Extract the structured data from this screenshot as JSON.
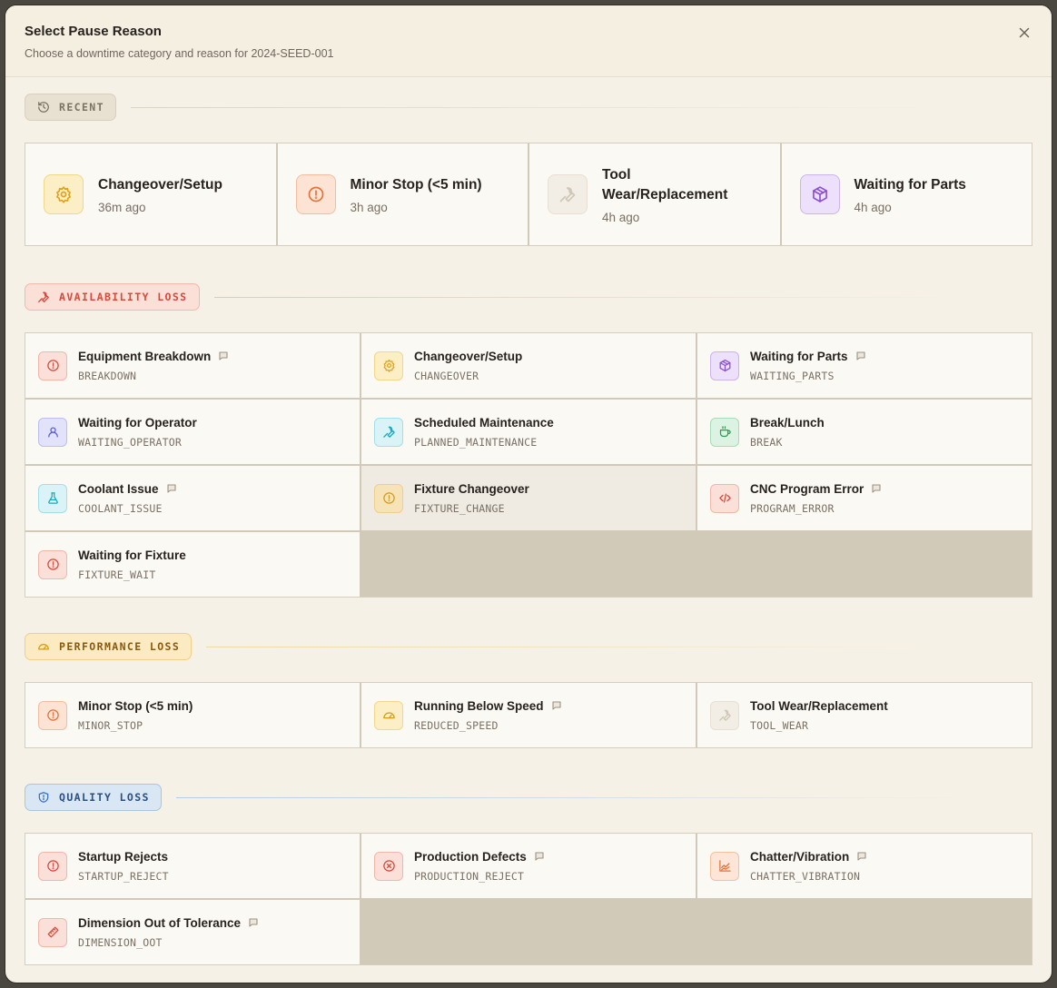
{
  "dialog": {
    "title": "Select Pause Reason",
    "subtitle": "Choose a downtime category and reason for 2024-SEED-001"
  },
  "recent": {
    "label": "RECENT",
    "items": [
      {
        "name": "Changeover/Setup",
        "time": "36m ago",
        "icon": "gear-icon",
        "color": "#e8a31c"
      },
      {
        "name": "Minor Stop (<5 min)",
        "time": "3h ago",
        "icon": "alert-circle-icon",
        "color": "#e0723a"
      },
      {
        "name": "Tool Wear/Replacement",
        "time": "4h ago",
        "icon": "wrench-icon",
        "color": "#c9bfae"
      },
      {
        "name": "Waiting for Parts",
        "time": "4h ago",
        "icon": "package-icon",
        "color": "#8b4fd1"
      }
    ]
  },
  "availability": {
    "label": "AVAILABILITY LOSS",
    "items": [
      {
        "name": "Equipment Breakdown",
        "code": "BREAKDOWN",
        "icon": "alert-circle-icon",
        "note": true
      },
      {
        "name": "Changeover/Setup",
        "code": "CHANGEOVER",
        "icon": "gear-icon",
        "note": false
      },
      {
        "name": "Waiting for Parts",
        "code": "WAITING_PARTS",
        "icon": "package-icon",
        "note": true
      },
      {
        "name": "Waiting for Operator",
        "code": "WAITING_OPERATOR",
        "icon": "user-icon",
        "note": false
      },
      {
        "name": "Scheduled Maintenance",
        "code": "PLANNED_MAINTENANCE",
        "icon": "wrench-icon",
        "note": false
      },
      {
        "name": "Break/Lunch",
        "code": "BREAK",
        "icon": "coffee-icon",
        "note": false
      },
      {
        "name": "Coolant Issue",
        "code": "COOLANT_ISSUE",
        "icon": "flask-icon",
        "note": true
      },
      {
        "name": "Fixture Changeover",
        "code": "FIXTURE_CHANGE",
        "icon": "alert-circle-icon",
        "note": false
      },
      {
        "name": "CNC Program Error",
        "code": "PROGRAM_ERROR",
        "icon": "code-icon",
        "note": true
      },
      {
        "name": "Waiting for Fixture",
        "code": "FIXTURE_WAIT",
        "icon": "alert-circle-icon",
        "note": false
      }
    ]
  },
  "performance": {
    "label": "PERFORMANCE LOSS",
    "items": [
      {
        "name": "Minor Stop (<5 min)",
        "code": "MINOR_STOP",
        "icon": "alert-circle-icon",
        "note": false
      },
      {
        "name": "Running Below Speed",
        "code": "REDUCED_SPEED",
        "icon": "gauge-icon",
        "note": true
      },
      {
        "name": "Tool Wear/Replacement",
        "code": "TOOL_WEAR",
        "icon": "wrench-icon",
        "note": false
      }
    ]
  },
  "quality": {
    "label": "QUALITY LOSS",
    "items": [
      {
        "name": "Startup Rejects",
        "code": "STARTUP_REJECT",
        "icon": "alert-circle-icon",
        "note": false
      },
      {
        "name": "Production Defects",
        "code": "PRODUCTION_REJECT",
        "icon": "x-circle-icon",
        "note": true
      },
      {
        "name": "Chatter/Vibration",
        "code": "CHATTER_VIBRATION",
        "icon": "chart-icon",
        "note": true
      },
      {
        "name": "Dimension Out of Tolerance",
        "code": "DIMENSION_OOT",
        "icon": "ruler-icon",
        "note": true
      }
    ]
  }
}
